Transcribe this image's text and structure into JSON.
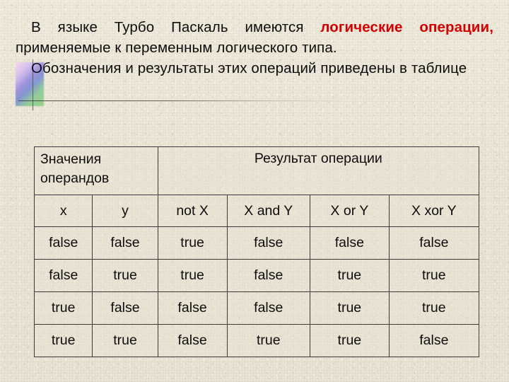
{
  "slide": {
    "background_color": "#e9e3d4",
    "text_color": "#0d0d0d",
    "accent_color": "#d20000",
    "border_color": "#3a3a3a"
  },
  "body_text": {
    "line1_a": "В языке Турбо Паскаль имеются ",
    "line1_highlight": "логические операции,",
    "line1_b": " применяемые к переменным логического типа.",
    "paragraph2": "Обозначения и результаты этих операций приведены в таблице"
  },
  "table": {
    "group_headers": {
      "operands": "Значения операндов",
      "result": "Результат операции"
    },
    "columns": [
      "x",
      "y",
      "not X",
      "X and Y",
      "X or Y",
      "X xor Y"
    ],
    "rows": [
      [
        "false",
        "false",
        "true",
        "false",
        "false",
        "false"
      ],
      [
        "false",
        "true",
        "true",
        "false",
        "true",
        "true"
      ],
      [
        "true",
        "false",
        "false",
        "false",
        "true",
        "true"
      ],
      [
        "true",
        "true",
        "false",
        "true",
        "true",
        "false"
      ]
    ]
  },
  "decoration": {
    "gradient_block": "gradient-square-decoration",
    "cross_line": "cross-line-decoration",
    "rule_line": "horizontal-rule-decoration"
  }
}
